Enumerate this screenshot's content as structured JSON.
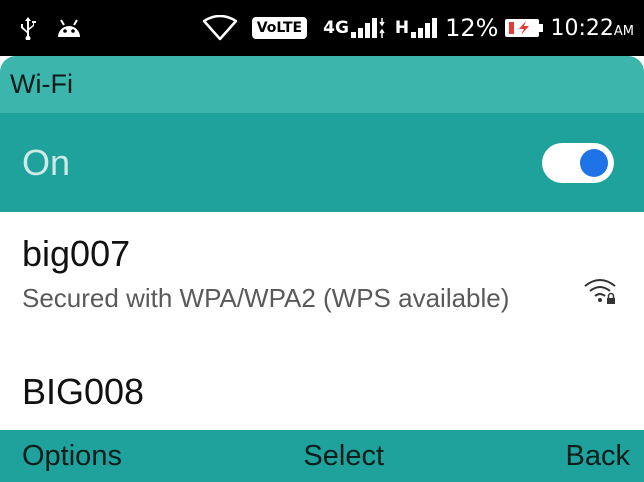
{
  "status_bar": {
    "icons": [
      "usb-icon",
      "android-icon",
      "wifi-outline-icon"
    ],
    "volte": "VoLTE",
    "network_4g": "4G",
    "network_h": "H",
    "battery_percent": "12%",
    "time": "10:22",
    "time_suffix": "AM"
  },
  "header": {
    "title": "Wi-Fi"
  },
  "toggle": {
    "label": "On",
    "state": true
  },
  "networks": [
    {
      "name": "big007",
      "status": "Secured with WPA/WPA2 (WPS available)",
      "icon": "wifi-locked-icon"
    },
    {
      "name": "BIG008"
    }
  ],
  "softkeys": {
    "left": "Options",
    "center": "Select",
    "right": "Back"
  },
  "colors": {
    "header": "#3cb6ad",
    "toggle_row": "#1fa29c",
    "switch_knob": "#1e73e6"
  }
}
